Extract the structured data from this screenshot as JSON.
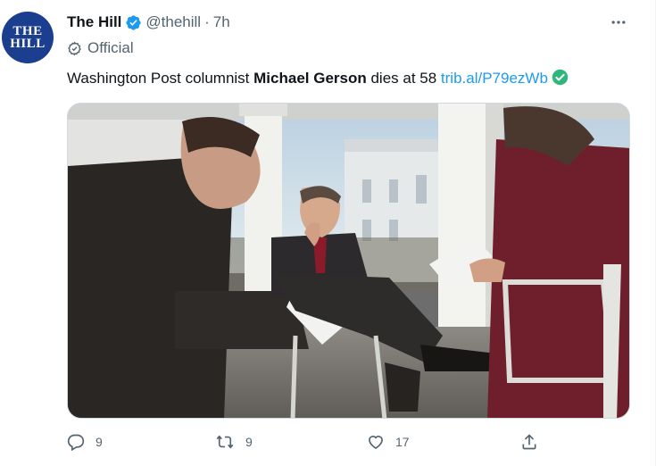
{
  "tweet": {
    "author_name": "The Hill",
    "avatar_text_line1": "THE",
    "avatar_text_line2": "HILL",
    "handle": "@thehill",
    "separator": "·",
    "time": "7h",
    "label": "Official",
    "text_prefix": "Washington Post columnist ",
    "text_bold": "Michael Gerson",
    "text_suffix": " dies at 58 ",
    "link": "trib.al/P79ezWb"
  },
  "actions": {
    "reply_count": "9",
    "retweet_count": "9",
    "like_count": "17"
  },
  "icons": {
    "verified": "verified-badge-icon",
    "official": "official-badge-icon",
    "more": "more-horizontal-icon",
    "link_check": "check-circle-icon",
    "reply": "reply-icon",
    "retweet": "retweet-icon",
    "like": "heart-icon",
    "share": "share-icon"
  },
  "colors": {
    "brand_blue": "#1d9bf0",
    "avatar_bg": "#1c3e8f",
    "secondary_text": "#536471",
    "check_green": "#2fb67c"
  }
}
